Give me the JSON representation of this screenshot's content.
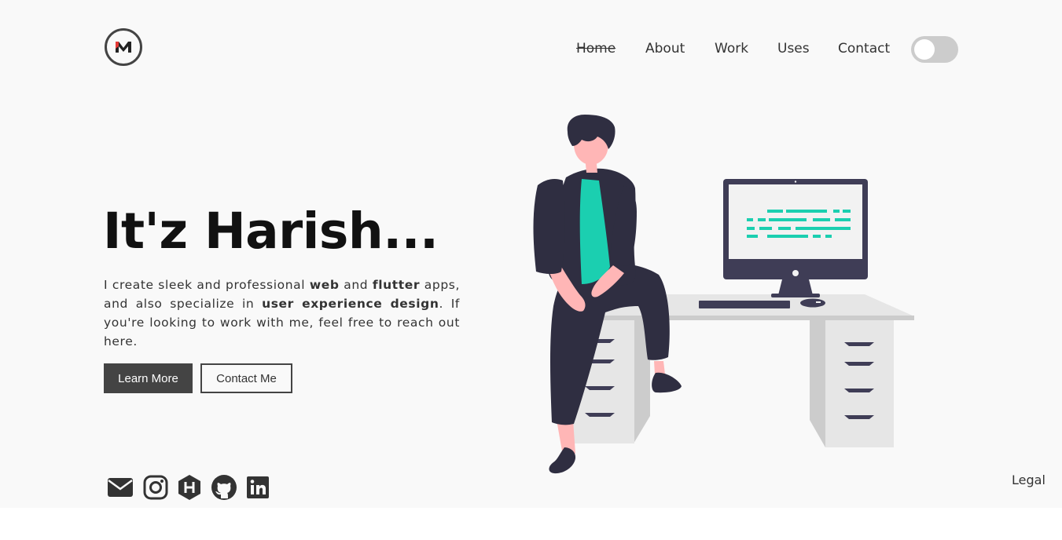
{
  "logo": {
    "text": "M",
    "accent_color": "#e53935"
  },
  "nav": {
    "items": [
      {
        "label": "Home",
        "active": true
      },
      {
        "label": "About"
      },
      {
        "label": "Work"
      },
      {
        "label": "Uses"
      },
      {
        "label": "Contact"
      }
    ],
    "theme_toggle": {
      "checked": false
    }
  },
  "hero": {
    "title": "It'z Harish...",
    "description": {
      "t1": "I create sleek and professional ",
      "b1": "web",
      "t2": " and ",
      "b2": "flutter",
      "t3": " apps, and also specialize in ",
      "b3": "user experience design",
      "t4": ". If you're looking to work with me, feel free to reach out here."
    },
    "buttons": {
      "learn_more": "Learn More",
      "contact_me": "Contact Me"
    }
  },
  "socials": [
    "mail-icon",
    "instagram-icon",
    "hashnode-icon",
    "github-icon",
    "linkedin-icon"
  ],
  "footer": {
    "legal": "Legal"
  },
  "colors": {
    "accent": "#1bcfb0",
    "dark": "#2f2e41",
    "skin": "#ffb6b6",
    "button": "#444444"
  }
}
